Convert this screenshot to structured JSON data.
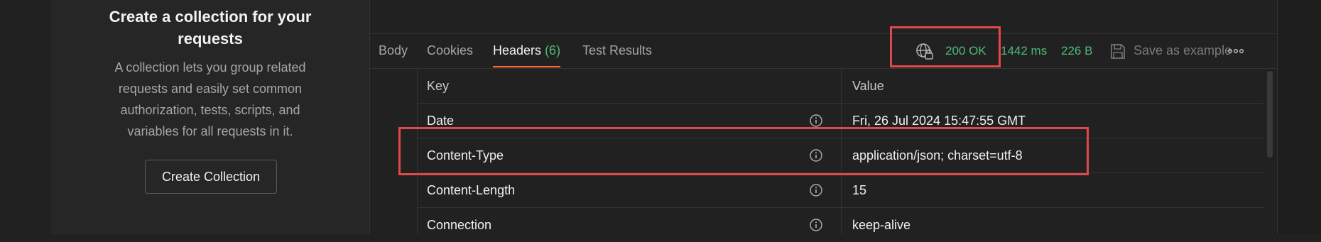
{
  "sidebar": {
    "title_line1": "Create a collection for your",
    "title_line2": "requests",
    "desc_line1": "A collection lets you group related",
    "desc_line2": "requests and easily set common",
    "desc_line3": "authorization, tests, scripts, and",
    "desc_line4": "variables for all requests in it.",
    "create_button": "Create Collection"
  },
  "tabs": {
    "body": "Body",
    "cookies": "Cookies",
    "headers": "Headers",
    "headers_count": "(6)",
    "test_results": "Test Results"
  },
  "response": {
    "status": "200 OK",
    "time": "1442 ms",
    "size": "226 B",
    "save_label": "Save as example",
    "status_color": "#4cbb75"
  },
  "headers_table": {
    "col_key": "Key",
    "col_value": "Value",
    "rows": [
      {
        "key": "Date",
        "value": "Fri, 26 Jul 2024 15:47:55 GMT"
      },
      {
        "key": "Content-Type",
        "value": "application/json; charset=utf-8"
      },
      {
        "key": "Content-Length",
        "value": "15"
      },
      {
        "key": "Connection",
        "value": "keep-alive"
      }
    ]
  },
  "colors": {
    "accent": "#ff6c37",
    "success": "#4cbb75",
    "highlight": "#e2474b"
  },
  "icons": [
    "globe-lock-icon",
    "save-icon",
    "more-icon",
    "info-icon"
  ]
}
